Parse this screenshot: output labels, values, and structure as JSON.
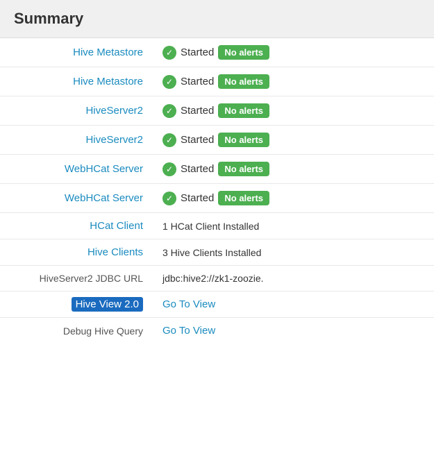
{
  "header": {
    "title": "Summary"
  },
  "rows": [
    {
      "id": "hive-metastore-1",
      "label": "Hive Metastore",
      "label_is_link": true,
      "type": "status",
      "status": "Started",
      "badge": "No alerts"
    },
    {
      "id": "hive-metastore-2",
      "label": "Hive Metastore",
      "label_is_link": true,
      "type": "status",
      "status": "Started",
      "badge": "No alerts"
    },
    {
      "id": "hiveserver2-1",
      "label": "HiveServer2",
      "label_is_link": true,
      "type": "status",
      "status": "Started",
      "badge": "No alerts"
    },
    {
      "id": "hiveserver2-2",
      "label": "HiveServer2",
      "label_is_link": true,
      "type": "status",
      "status": "Started",
      "badge": "No alerts"
    },
    {
      "id": "webhcat-server-1",
      "label": "WebHCat Server",
      "label_is_link": true,
      "type": "status",
      "status": "Started",
      "badge": "No alerts"
    },
    {
      "id": "webhcat-server-2",
      "label": "WebHCat Server",
      "label_is_link": true,
      "type": "status",
      "status": "Started",
      "badge": "No alerts"
    },
    {
      "id": "hcat-client",
      "label": "HCat Client",
      "label_is_link": true,
      "type": "text",
      "value": "1 HCat Client Installed"
    },
    {
      "id": "hive-clients",
      "label": "Hive Clients",
      "label_is_link": true,
      "type": "text",
      "value": "3 Hive Clients Installed"
    },
    {
      "id": "hiveserver2-jdbc",
      "label": "HiveServer2 JDBC URL",
      "label_is_link": false,
      "type": "text",
      "value": "jdbc:hive2://zk1-zoozie."
    },
    {
      "id": "hive-view-2",
      "label": "Hive View 2.0",
      "label_is_link": false,
      "label_highlighted": true,
      "type": "link",
      "link_text": "Go To View",
      "link_href": "#"
    },
    {
      "id": "debug-hive-query",
      "label": "Debug Hive Query",
      "label_is_link": false,
      "type": "link",
      "link_text": "Go To View",
      "link_href": "#"
    }
  ],
  "badges": {
    "no_alerts": "No alerts"
  },
  "links": {
    "go_to_view": "Go To View"
  }
}
